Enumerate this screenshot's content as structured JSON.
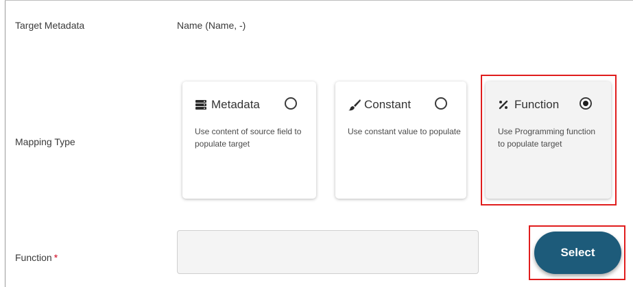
{
  "target_metadata": {
    "label": "Target Metadata",
    "value": "Name (Name, -)"
  },
  "mapping_type": {
    "label": "Mapping Type",
    "options": [
      {
        "title": "Metadata",
        "icon": "database-icon",
        "description": "Use content of source field to populate target",
        "selected": false
      },
      {
        "title": "Constant",
        "icon": "brush-icon",
        "description": "Use constant value to populate",
        "selected": false
      },
      {
        "title": "Function",
        "icon": "percent-icon",
        "description": "Use Programming function to populate target",
        "selected": true
      }
    ]
  },
  "function_field": {
    "label": "Function",
    "required_marker": "*",
    "value": ""
  },
  "select_button": {
    "label": "Select"
  },
  "colors": {
    "button": "#1d5b7a",
    "highlight": "#e01c1c",
    "required": "#d0021b"
  }
}
